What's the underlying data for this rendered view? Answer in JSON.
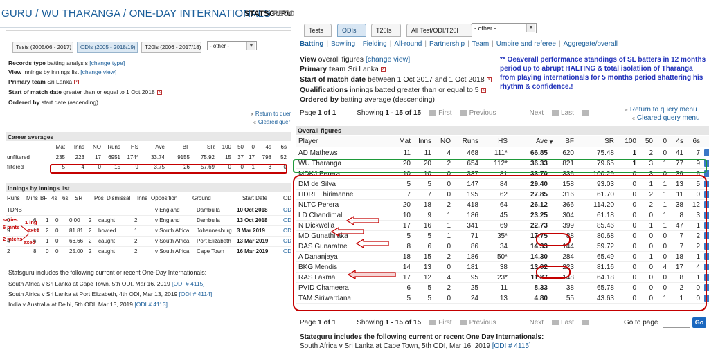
{
  "left": {
    "title": "GURU / WU THARANGA / ONE-DAY INTERNATIONALS",
    "header_link1": "STATSGURU",
    "header_link2": "RECO",
    "tabs": [
      "Tests (2005/06 - 2017)",
      "ODIs (2005 - 2018/19)",
      "T20Is (2006 - 2017/18)"
    ],
    "other_select": "- other -",
    "records_type_label": "Records type",
    "records_type_value": "batting analysis",
    "change_type": "[change type]",
    "view_label": "View",
    "view_value": "innings by innings list",
    "change_view": "[change view]",
    "team_label": "Primary team",
    "team_value": "Sri Lanka",
    "start_label": "Start of match date",
    "start_value": "greater than or equal to 1 Oct 2018",
    "ordered_label": "Ordered by",
    "ordered_value": "start date (ascending)",
    "return_query": "Return to quer",
    "cleared_query": "Cleared quer",
    "career_title": "Career averages",
    "career_headers": [
      "Mat",
      "Inns",
      "NO",
      "Runs",
      "HS",
      "Ave",
      "BF",
      "SR",
      "100",
      "50",
      "0",
      "4s",
      "6s"
    ],
    "career_rows": [
      {
        "label": "unfiltered",
        "vals": [
          "235",
          "223",
          "17",
          "6951",
          "174*",
          "33.74",
          "9155",
          "75.92",
          "15",
          "37",
          "17",
          "798",
          "52"
        ]
      },
      {
        "label": "filtered",
        "vals": [
          "5",
          "4",
          "0",
          "15",
          "9",
          "3.75",
          "26",
          "57.69",
          "0",
          "0",
          "1",
          "3",
          "0"
        ]
      }
    ],
    "innings_title": "Innings by innings list",
    "innings_headers": [
      "Runs",
      "Mins",
      "BF",
      "4s",
      "6s",
      "SR",
      "Pos",
      "Dismissal",
      "Inns",
      "",
      "Opposition",
      "Ground",
      "Start Date"
    ],
    "innings_rows": [
      {
        "runs": "TDNB",
        "mins": "",
        "bf": "",
        "fours": "",
        "sixes": "",
        "sr": "",
        "pos": "",
        "dis": "",
        "inns": "",
        "opp": "v England",
        "ground": "Dambulla",
        "date": "10 Oct 2018"
      },
      {
        "runs": "0",
        "mins": "",
        "bf": "6",
        "fours": "1",
        "sixes": "0",
        "sr": "0.00",
        "pos": "2",
        "dis": "caught",
        "inns": "2",
        "opp": "v England",
        "ground": "Dambulla",
        "date": "13 Oct 2018"
      },
      {
        "runs": "9",
        "mins": "",
        "bf": "11",
        "fours": "2",
        "sixes": "0",
        "sr": "81.81",
        "pos": "2",
        "dis": "bowled",
        "inns": "1",
        "opp": "v South Africa",
        "ground": "Johannesburg",
        "date": "3 Mar 2019"
      },
      {
        "runs": "4",
        "mins": "",
        "bf": "6",
        "fours": "1",
        "sixes": "0",
        "sr": "66.66",
        "pos": "2",
        "dis": "caught",
        "inns": "2",
        "opp": "v South Africa",
        "ground": "Port Elizabeth",
        "date": "13 Mar 2019"
      },
      {
        "runs": "2",
        "mins": "",
        "bf": "8",
        "fours": "0",
        "sixes": "0",
        "sr": "25.00",
        "pos": "2",
        "dis": "caught",
        "inns": "2",
        "opp": "v South Africa",
        "ground": "Cape Town",
        "date": "16 Mar 2019"
      }
    ],
    "odi_col": "ODI",
    "notes": {
      "series": "series",
      "ing1": "1 ing",
      "mnts6": "6 mnts",
      "axed1": "axed",
      "mtchs2": "2 mtchs",
      "axed2": "axed"
    },
    "includes_title": "Statsguru includes the following current or recent One-Day Internationals:",
    "includes": [
      {
        "text": "South Africa v Sri Lanka at Cape Town, 5th ODI, Mar 16, 2019",
        "link": "[ODI # 4115]"
      },
      {
        "text": "South Africa v Sri Lanka at Port Elizabeth, 4th ODI, Mar 13, 2019",
        "link": "[ODI # 4114]"
      },
      {
        "text": "India v Australia at Delhi, 5th ODI, Mar 13, 2019",
        "link": "[ODI # 4113]"
      }
    ]
  },
  "right": {
    "tabs": [
      "Tests",
      "ODIs",
      "T20Is",
      "All Test/ODI/T20I"
    ],
    "other_select": "- other -",
    "nav": [
      "Batting",
      "Bowling",
      "Fielding",
      "All-round",
      "Partnership",
      "Team",
      "Umpire and referee",
      "Aggregate/overall"
    ],
    "view_label": "View",
    "view_value": "overall figures",
    "change_view": "[change view]",
    "team_label": "Primary team",
    "team_value": "Sri Lanka",
    "start_label": "Start of match date",
    "start_value": "between 1 Oct 2017 and 1 Oct 2018",
    "qual_label": "Qualifications",
    "qual_value": "innings batted greater than or equal to 5",
    "ordered_label": "Ordered by",
    "ordered_value": "batting average (descending)",
    "blue_note": "** Oeaverall performance standings of SL batters in 12 months period up to abrupt HALTING & total isolatiion of Tharanga from playing internationals for 5 months period shattering his rhythm & confidence.!",
    "page_label": "Page",
    "page_value": "1 of 1",
    "showing_label": "Showing",
    "showing_value": "1 - 15 of 15",
    "first": "First",
    "previous": "Previous",
    "next": "Next",
    "last": "Last",
    "return_query": "Return to query menu",
    "cleared_query": "Cleared query menu",
    "overall_title": "Overall figures",
    "headers": [
      "Player",
      "Mat",
      "Inns",
      "NO",
      "Runs",
      "HS",
      "Ave",
      "BF",
      "SR",
      "100",
      "50",
      "0",
      "4s",
      "6s"
    ],
    "rows": [
      [
        "AD Mathews",
        "11",
        "11",
        "4",
        "468",
        "111*",
        "66.85",
        "620",
        "75.48",
        "1",
        "2",
        "0",
        "41",
        "7"
      ],
      [
        "WU Tharanga",
        "20",
        "20",
        "2",
        "654",
        "112*",
        "36.33",
        "821",
        "79.65",
        "1",
        "3",
        "1",
        "77",
        "9"
      ],
      [
        "MDKJ Perera",
        "10",
        "10",
        "0",
        "337",
        "81",
        "33.70",
        "336",
        "100.29",
        "0",
        "3",
        "0",
        "39",
        "6"
      ],
      [
        "DM de Silva",
        "5",
        "5",
        "0",
        "147",
        "84",
        "29.40",
        "158",
        "93.03",
        "0",
        "1",
        "1",
        "13",
        "5"
      ],
      [
        "HDRL Thirimanne",
        "7",
        "7",
        "0",
        "195",
        "62",
        "27.85",
        "316",
        "61.70",
        "0",
        "2",
        "1",
        "11",
        "0"
      ],
      [
        "NLTC Perera",
        "20",
        "18",
        "2",
        "418",
        "64",
        "26.12",
        "366",
        "114.20",
        "0",
        "2",
        "1",
        "38",
        "12"
      ],
      [
        "LD Chandimal",
        "10",
        "9",
        "1",
        "186",
        "45",
        "23.25",
        "304",
        "61.18",
        "0",
        "0",
        "1",
        "8",
        "3"
      ],
      [
        "N Dickwella",
        "17",
        "16",
        "1",
        "341",
        "69",
        "22.73",
        "399",
        "85.46",
        "0",
        "1",
        "1",
        "47",
        "1"
      ],
      [
        "MD Gunathilaka",
        "5",
        "5",
        "1",
        "71",
        "35*",
        "17.75",
        "88",
        "80.68",
        "0",
        "0",
        "0",
        "7",
        "2"
      ],
      [
        "DAS Gunaratne",
        "8",
        "6",
        "0",
        "86",
        "34",
        "14.33",
        "144",
        "59.72",
        "0",
        "0",
        "0",
        "7",
        "2"
      ],
      [
        "A Dananjaya",
        "18",
        "15",
        "2",
        "186",
        "50*",
        "14.30",
        "284",
        "65.49",
        "0",
        "1",
        "0",
        "18",
        "1"
      ],
      [
        "BKG Mendis",
        "14",
        "13",
        "0",
        "181",
        "38",
        "13.92",
        "223",
        "81.16",
        "0",
        "0",
        "4",
        "17",
        "4"
      ],
      [
        "RAS Lakmal",
        "17",
        "12",
        "4",
        "95",
        "23*",
        "11.87",
        "148",
        "64.18",
        "0",
        "0",
        "0",
        "8",
        "1"
      ],
      [
        "PVID Chameera",
        "6",
        "5",
        "2",
        "25",
        "11",
        "8.33",
        "38",
        "65.78",
        "0",
        "0",
        "0",
        "2",
        "0"
      ],
      [
        "TAM Siriwardana",
        "5",
        "5",
        "0",
        "24",
        "13",
        "4.80",
        "55",
        "43.63",
        "0",
        "0",
        "1",
        "1",
        "0"
      ]
    ],
    "goto_label": "Go to page",
    "go_button": "Go",
    "bottom_title": "Stateguru includes the following current or recent One Day Internationals:",
    "bottom_text": "South Africa v Sri Lanka at Cape Town, 5th ODI, Mar 16, 2019",
    "bottom_link": "[ODI # 4115]"
  }
}
